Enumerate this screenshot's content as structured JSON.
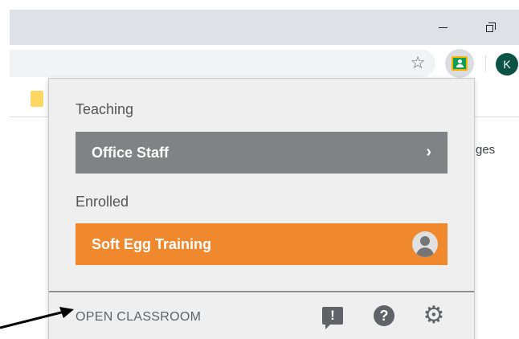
{
  "window": {
    "minimize_glyph": "—",
    "maximize_glyph": "❐"
  },
  "toolbar": {
    "bookmark_icon": "star-icon",
    "extension_icon": "google-classroom-icon",
    "profile_initial": "K"
  },
  "page": {
    "partial_text": "ges"
  },
  "popup": {
    "teaching_label": "Teaching",
    "teaching_classes": [
      {
        "name": "Office Staff",
        "chevron": "›"
      }
    ],
    "enrolled_label": "Enrolled",
    "enrolled_classes": [
      {
        "name": "Soft Egg Training"
      }
    ],
    "open_classroom_label": "OPEN CLASSROOM",
    "footer_icons": [
      "feedback-icon",
      "help-icon",
      "settings-icon"
    ],
    "feedback_glyph": "!",
    "help_glyph": "?",
    "settings_glyph": "⚙"
  },
  "colors": {
    "teaching_card": "#808285",
    "enrolled_card": "#f0892e",
    "avatar": "#0b5345",
    "popup_bg": "#efefef"
  }
}
